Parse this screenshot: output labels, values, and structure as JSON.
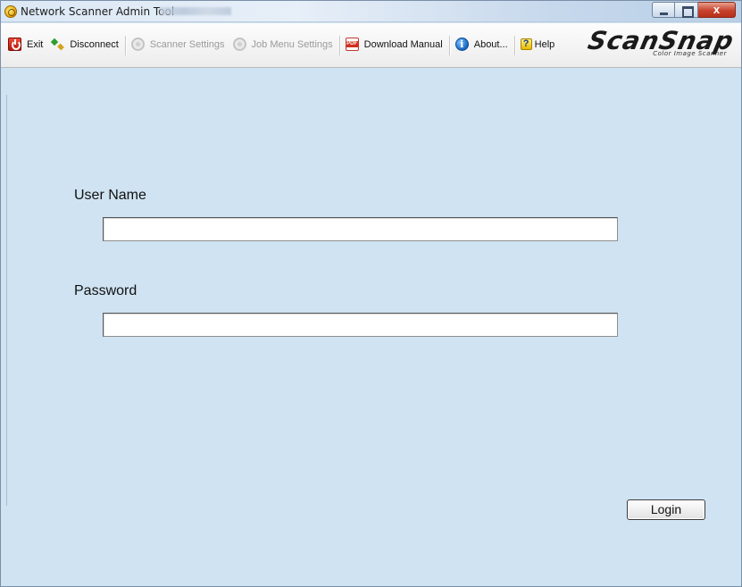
{
  "window": {
    "title": "Network Scanner Admin Tool",
    "controls": {
      "minimize": "minimize",
      "maximize": "maximize",
      "close": "x"
    }
  },
  "toolbar": {
    "items": [
      {
        "label": "Exit",
        "icon": "exit-icon",
        "enabled": true
      },
      {
        "label": "Disconnect",
        "icon": "disconnect-icon",
        "enabled": true
      },
      {
        "label": "Scanner Settings",
        "icon": "gear-icon",
        "enabled": false
      },
      {
        "label": "Job Menu Settings",
        "icon": "gear-icon",
        "enabled": false
      },
      {
        "label": "Download Manual",
        "icon": "pdf-icon",
        "enabled": true
      },
      {
        "label": "About...",
        "icon": "info-icon",
        "enabled": true
      },
      {
        "label": "Help",
        "icon": "help-icon",
        "enabled": true
      }
    ]
  },
  "brand": {
    "name": "ScanSnap",
    "tagline": "Color Image Scanner"
  },
  "login": {
    "username_label": "User Name",
    "username_value": "",
    "password_label": "Password",
    "password_value": "",
    "submit_label": "Login"
  },
  "colors": {
    "content_background": "#cfe3f2",
    "toolbar_background": "#f4f4f4"
  }
}
